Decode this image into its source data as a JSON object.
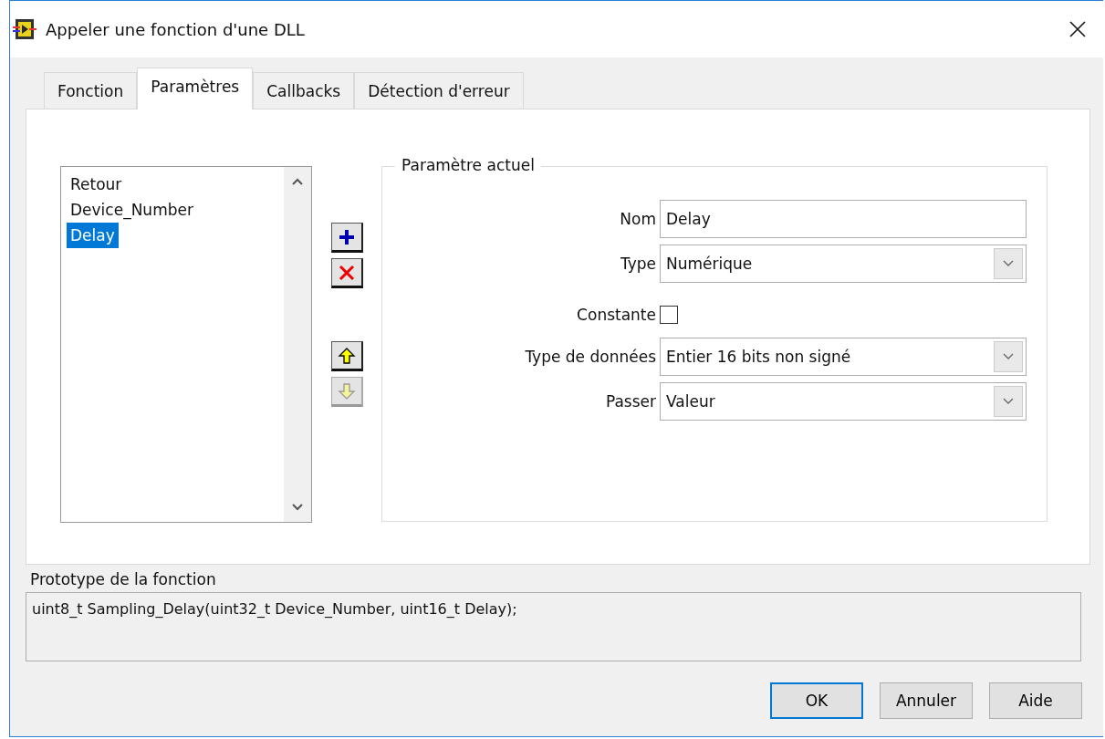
{
  "window": {
    "title": "Appeler une fonction d'une DLL"
  },
  "tabs": [
    {
      "label": "Fonction",
      "selected": false
    },
    {
      "label": "Paramètres",
      "selected": true
    },
    {
      "label": "Callbacks",
      "selected": false
    },
    {
      "label": "Détection d'erreur",
      "selected": false
    }
  ],
  "parameter_list": {
    "items": [
      {
        "label": "Retour",
        "selected": false
      },
      {
        "label": "Device_Number",
        "selected": false
      },
      {
        "label": "Delay",
        "selected": true
      }
    ]
  },
  "list_buttons": [
    {
      "kind": "add",
      "disabled": false
    },
    {
      "kind": "delete",
      "disabled": false
    },
    {
      "kind": "up",
      "disabled": false
    },
    {
      "kind": "down",
      "disabled": true
    }
  ],
  "current_parameter": {
    "title": "Paramètre actuel",
    "fields": [
      {
        "kind": "text",
        "label": "Nom",
        "value": "Delay"
      },
      {
        "kind": "combo",
        "label": "Type",
        "value": "Numérique"
      },
      {
        "kind": "checkbox",
        "label": "Constante",
        "checked": false
      },
      {
        "kind": "combo",
        "label": "Type de données",
        "value": "Entier 16 bits non signé"
      },
      {
        "kind": "combo",
        "label": "Passer",
        "value": "Valeur"
      }
    ]
  },
  "prototype": {
    "label": "Prototype de la fonction",
    "value": "uint8_t Sampling_Delay(uint32_t Device_Number, uint16_t Delay);"
  },
  "buttons": [
    {
      "label": "OK",
      "default": true
    },
    {
      "label": "Annuler",
      "default": false
    },
    {
      "label": "Aide",
      "default": false
    }
  ]
}
